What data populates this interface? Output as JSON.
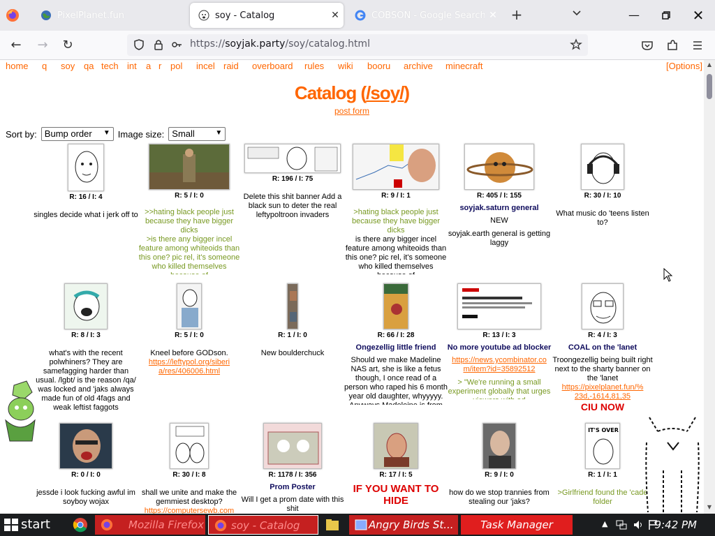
{
  "browser": {
    "tabs": [
      {
        "title": "PixelPlanet.fun",
        "active": false
      },
      {
        "title": "soy - Catalog",
        "active": true
      },
      {
        "title": "COBSON - Google Search",
        "active": false
      }
    ],
    "url_prefix": "https://",
    "url_host": "soyjak.party",
    "url_path": "/soy/catalog.html"
  },
  "boardlist": [
    "home",
    "q",
    "soy",
    "qa",
    "tech",
    "int",
    "a",
    "r",
    "pol",
    "incel",
    "raid",
    "overboard",
    "rules",
    "wiki",
    "booru",
    "archive",
    "minecraft"
  ],
  "options_label": "[Options]",
  "catalog": {
    "title_prefix": "Catalog (",
    "title_board": "/soy/",
    "title_suffix": ")",
    "post_form": "post form",
    "sort_label": "Sort by:",
    "sort_value": "Bump order",
    "size_label": "Image size:",
    "size_value": "Small"
  },
  "threads": [
    {
      "meta": "R: 16 / I: 4",
      "subject": "",
      "body": "singles decide what i jerk off to"
    },
    {
      "meta": "R: 5 / I: 0",
      "subject": "",
      "green": ">>hating black people just because they have bigger dicks",
      "green2": ">is there any bigger incel feature among whiteoids than this one? pic rel, it's someone who killed themselves because of"
    },
    {
      "meta": "R: 196 / I: 75",
      "subject": "",
      "body": "Delete this shit banner Add a black sun to deter the real leftypoltroon invaders"
    },
    {
      "meta": "R: 9 / I: 1",
      "subject": "",
      "green": ">hating black people just because they have bigger dicks",
      "body": "is there any bigger incel feature among whiteoids than this one? pic rel, it's someone who killed themselves because of"
    },
    {
      "meta": "R: 405 / I: 155",
      "subject": "soyjak.saturn general",
      "body": "NEW",
      "body2": "soyjak.earth general is getting laggy"
    },
    {
      "meta": "R: 30 / I: 10",
      "subject": "",
      "body": "What music do 'teens listen to?"
    },
    {
      "meta": "R: 8 / I: 3",
      "subject": "",
      "body": "what's with the recent polwhiners? They are samefagging harder than usual. /lgbt/ is the reason /qa/ was locked and 'jaks always made fun of old 4fags and weak leftist faggots"
    },
    {
      "meta": "R: 5 / I: 0",
      "subject": "",
      "body": "Kneel before GODson.",
      "link": "https://leftypol.org/siberia/res/406006.html"
    },
    {
      "meta": "R: 1 / I: 0",
      "subject": "",
      "body": "New boulderchuck"
    },
    {
      "meta": "R: 66 / I: 28",
      "subject": "Ongezellig little friend",
      "body": "Should we make Madeline NAS art, she is like a fetus though, I once read of a person who raped his 6 month year old daughter, whyyyyy. Anyways Madeleine is from either"
    },
    {
      "meta": "R: 13 / I: 3",
      "subject": "No more youtube ad blocker",
      "link": "https://news.ycombinator.com/item?id=35892512",
      "green": "> \"We're running a small experiment globally that urges viewers with ad"
    },
    {
      "meta": "R: 4 / I: 3",
      "subject": "COAL on the 'lanet",
      "body": "Troongezellig being built right next to the sharty banner on the 'lanet",
      "link": "https://pixelplanet.fun/%23d,-1614,81,35",
      "red": "CIU NOW"
    },
    {
      "meta": "R: 0 / I: 0",
      "subject": "",
      "body": "jessde i look fucking awful im soyboy wojax"
    },
    {
      "meta": "R: 30 / I: 8",
      "subject": "",
      "body": "shall we unite and make the gemmiest desktop?",
      "link": "https://computersewb.com"
    },
    {
      "meta": "R: 1178 / I: 356",
      "subject": "Prom Poster",
      "body": "Will I get a prom date with this shit"
    },
    {
      "meta": "R: 17 / I: 5",
      "subject_red": "IF YOU WANT TO HIDE"
    },
    {
      "meta": "R: 9 / I: 0",
      "subject": "",
      "body": "how do we stop trannies from stealing our 'jaks?"
    },
    {
      "meta": "R: 1 / I: 1",
      "subject": "",
      "green": ">Girlfriend found the 'cade folder"
    }
  ],
  "taskbar": {
    "start": "start",
    "items": [
      "Mozilla Firefox",
      "soy - Catalog",
      "Angry Birds St...",
      "Task Manager"
    ],
    "clock": "9:42 PM"
  },
  "colors": {
    "accent": "#ff6600",
    "subject": "#0f0c5d",
    "greentext": "#789922"
  }
}
